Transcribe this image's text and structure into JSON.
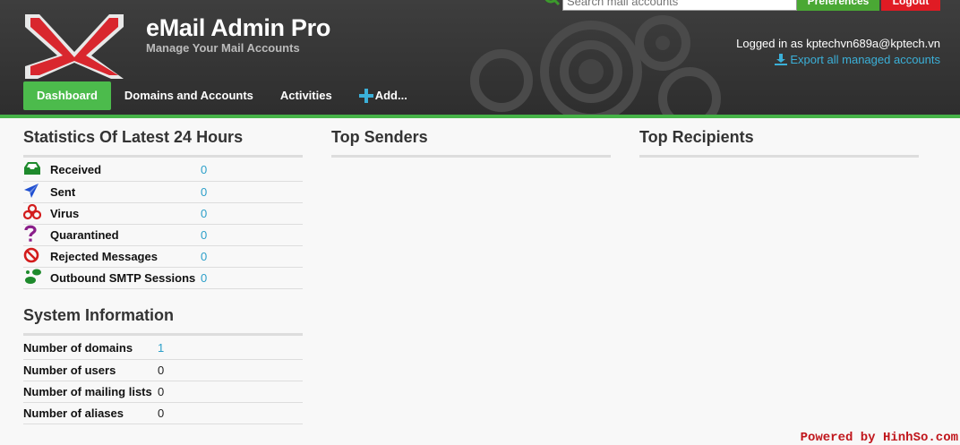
{
  "header": {
    "title": "eMail Admin Pro",
    "subtitle": "Manage Your Mail Accounts",
    "search_placeholder": "Search mail accounts",
    "preferences_label": "Preferences",
    "logout_label": "Logout",
    "logged_in_text": "Logged in as kptechvn689a@kptech.vn",
    "export_label": "Export all managed accounts"
  },
  "nav": {
    "items": [
      {
        "label": "Dashboard"
      },
      {
        "label": "Domains and Accounts"
      },
      {
        "label": "Activities"
      },
      {
        "label": "Add..."
      }
    ]
  },
  "stats": {
    "title": "Statistics Of Latest 24 Hours",
    "rows": [
      {
        "label": "Received",
        "value": "0",
        "icon": "inbox-icon"
      },
      {
        "label": "Sent",
        "value": "0",
        "icon": "paper-plane-icon"
      },
      {
        "label": "Virus",
        "value": "0",
        "icon": "biohazard-icon"
      },
      {
        "label": "Quarantined",
        "value": "0",
        "icon": "question-icon"
      },
      {
        "label": "Rejected Messages",
        "value": "0",
        "icon": "ban-icon"
      },
      {
        "label": "Outbound SMTP Sessions",
        "value": "0",
        "icon": "footprints-icon"
      }
    ]
  },
  "top_senders": {
    "title": "Top Senders"
  },
  "top_recipients": {
    "title": "Top Recipients"
  },
  "system_info": {
    "title": "System Information",
    "rows": [
      {
        "label": "Number of domains",
        "value": "1"
      },
      {
        "label": "Number of users",
        "value": "0"
      },
      {
        "label": "Number of mailing lists",
        "value": "0"
      },
      {
        "label": "Number of aliases",
        "value": "0"
      }
    ]
  },
  "footer": {
    "credit": "Powered by HinhSo.com"
  },
  "colors": {
    "accent_green": "#4cbb4c",
    "link_blue": "#2b9fc9",
    "logout_red": "#e01b24",
    "header_bg": "#333333"
  }
}
